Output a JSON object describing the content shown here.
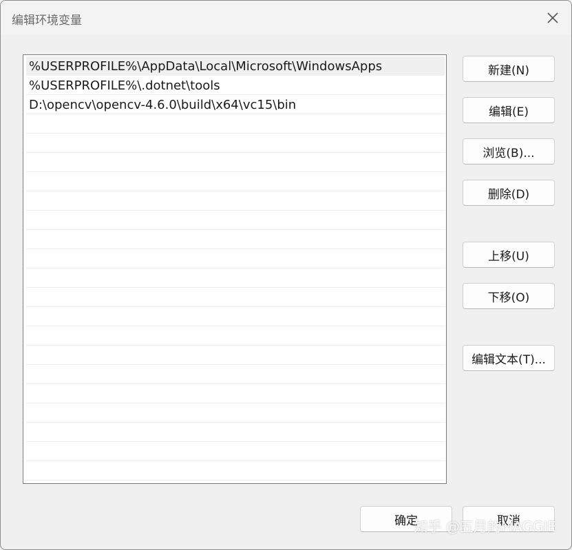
{
  "window": {
    "title": "编辑环境变量",
    "close_icon": "close-icon"
  },
  "path_list": {
    "items": [
      {
        "value": "%USERPROFILE%\\AppData\\Local\\Microsoft\\WindowsApps",
        "selected": true
      },
      {
        "value": "%USERPROFILE%\\.dotnet\\tools",
        "selected": false
      },
      {
        "value": "D:\\opencv\\opencv-4.6.0\\build\\x64\\vc15\\bin",
        "selected": false
      }
    ]
  },
  "side_buttons": {
    "new_label": "新建(N)",
    "edit_label": "编辑(E)",
    "browse_label": "浏览(B)...",
    "delete_label": "删除(D)",
    "move_up_label": "上移(U)",
    "move_down_label": "下移(O)",
    "edit_text_label": "编辑文本(T)..."
  },
  "footer": {
    "ok_label": "确定",
    "cancel_label": "取消"
  },
  "watermark": {
    "text": "知乎 @五月的MAGGIE"
  }
}
